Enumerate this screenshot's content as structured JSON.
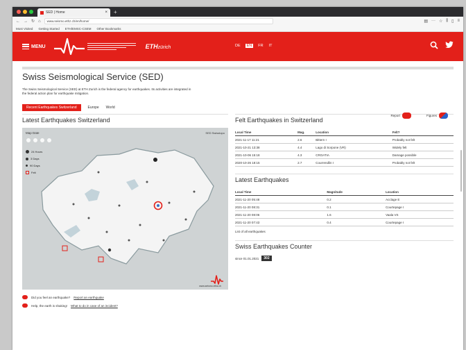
{
  "browser": {
    "tab_title": "SED | Home",
    "url": "www.seismo.ethz.ch/en/home/",
    "bookmarks": [
      "Most Visited",
      "Getting Started",
      "ETH/EMSC-CSEM"
    ],
    "bookmarks_right": "Other Bookmarks"
  },
  "header": {
    "menu_label": "MENU",
    "eth_label": "ETH",
    "eth_suffix": "zürich",
    "languages": [
      "DE",
      "EN",
      "FR",
      "IT"
    ],
    "active_language": "EN"
  },
  "page": {
    "title": "Swiss Seismological Service (SED)",
    "intro": "The Swiss Seismological Service (SED) at ETH Zurich is the federal agency for earthquakes. Its activities are integrated in the federal action plan for earthquake mitigation.",
    "actions": {
      "report": "Report",
      "figures": "Figures"
    },
    "tabs": [
      "Recent Earthquakes Switzerland",
      "Europe",
      "World"
    ],
    "active_tab": "Recent Earthquakes Switzerland"
  },
  "map": {
    "heading": "Latest Earthquakes Switzerland",
    "date_label": "Map Date",
    "source": "SED Swisstopo",
    "legend": [
      "24 Hours",
      "3 Days",
      "90 Days",
      "Felt"
    ],
    "scale_label": "www.seismo.ethz.ch"
  },
  "felt": {
    "heading": "Felt Earthquakes in Switzerland",
    "columns": [
      "Local Time",
      "Mag.",
      "Location",
      "Felt?"
    ],
    "rows": [
      [
        "2021-11-17 11:21",
        "2.6",
        "Bittern I",
        "Probably not felt"
      ],
      [
        "2021-10-21 13:38",
        "4.4",
        "Lago di Sorpone (VR)",
        "Widely felt"
      ],
      [
        "2021-10-06 15:18",
        "4.3",
        "CROATIA",
        "Damage possible"
      ],
      [
        "2020-10-26 18:15",
        "2.7",
        "Courrendlin I",
        "Probably not felt"
      ]
    ]
  },
  "latest": {
    "heading": "Latest Earthquakes",
    "columns": [
      "Local Time",
      "Magnitude",
      "Location"
    ],
    "rows": [
      [
        "2021-11-20 05:48",
        "0.2",
        "Acclage E"
      ],
      [
        "2021-11-20 08:31",
        "0.1",
        "Courtepage I"
      ],
      [
        "2021-11-20 08:06",
        "1.6",
        "Vaala VS"
      ],
      [
        "2021-11-20 07:43",
        "0.4",
        "Courtepage I"
      ]
    ],
    "list_link": "List of all earthquakes"
  },
  "counter": {
    "heading": "Swiss Earthquakes Counter",
    "since_label": "since 01.01.2021",
    "count": "302"
  },
  "bottom": {
    "q1": "Did you feel an earthquake?",
    "q1_link": "Report an earthquake",
    "q2": "Help, the earth is shaking!",
    "q2_link": "What to do in case of an incident?"
  },
  "colors": {
    "brand": "#e3201a"
  }
}
